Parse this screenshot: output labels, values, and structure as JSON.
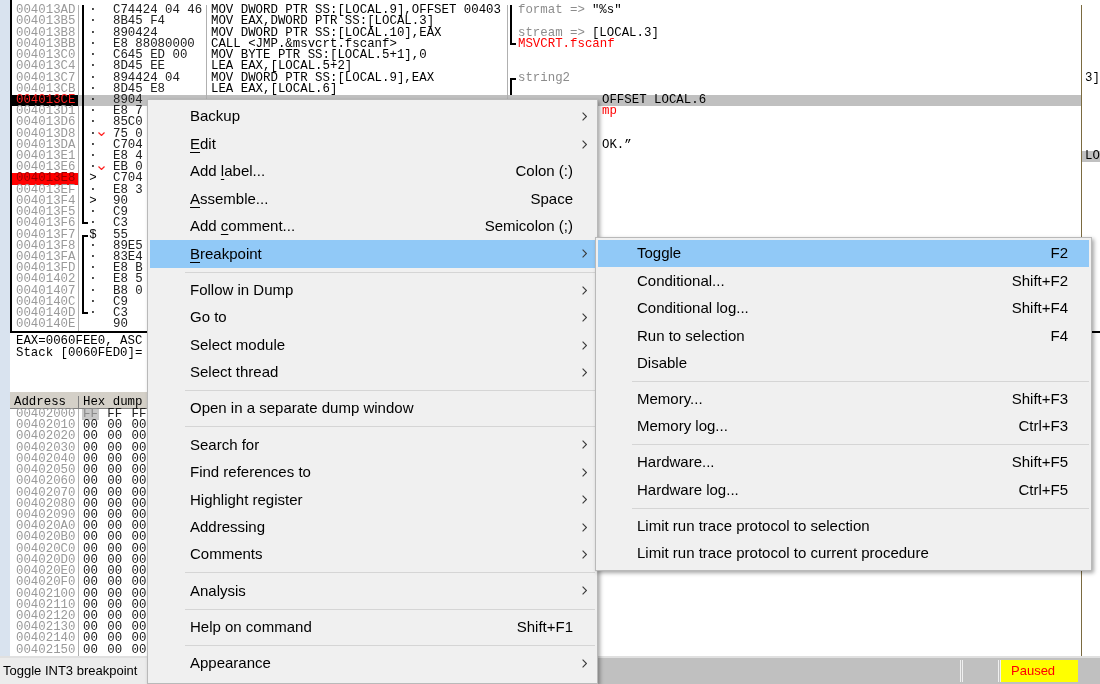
{
  "disassembly": {
    "rows": [
      {
        "address": "004013AD",
        "marker": "·",
        "jump": false,
        "bracket": {
          "kind": "middle"
        },
        "hex": "C74424 04 46",
        "instruction": "MOV DWORD PTR SS:[LOCAL.9],OFFSET 00403",
        "comment_bracket": {
          "kind": "middle"
        },
        "comment": {
          "kind": "arg",
          "name": "format =>",
          "value": "\"%s\""
        },
        "selected": false,
        "breakpoint": false
      },
      {
        "address": "004013B5",
        "marker": "·",
        "jump": false,
        "bracket": {
          "kind": "middle"
        },
        "hex": "8B45 F4",
        "instruction": "MOV EAX,DWORD PTR SS:[LOCAL.3]",
        "comment_bracket": {
          "kind": "middle"
        },
        "selected": false,
        "breakpoint": false
      },
      {
        "address": "004013B8",
        "marker": "·",
        "jump": false,
        "bracket": {
          "kind": "middle"
        },
        "hex": "890424",
        "instruction": "MOV DWORD PTR SS:[LOCAL.10],EAX",
        "comment_bracket": {
          "kind": "middle"
        },
        "comment": {
          "kind": "arg",
          "name": "stream =>",
          "value": "[LOCAL.3]"
        },
        "selected": false,
        "breakpoint": false
      },
      {
        "address": "004013BB",
        "marker": "·",
        "jump": false,
        "bracket": {
          "kind": "middle"
        },
        "hex": "E8 88080000",
        "instruction": "CALL <JMP.&msvcrt.fscanf>",
        "comment_bracket": {
          "kind": "end"
        },
        "comment": {
          "kind": "call",
          "text": "MSVCRT.fscanf"
        },
        "selected": false,
        "breakpoint": false
      },
      {
        "address": "004013C0",
        "marker": "·",
        "jump": false,
        "bracket": {
          "kind": "middle"
        },
        "hex": "C645 ED 00",
        "instruction": "MOV BYTE PTR SS:[LOCAL.5+1],0",
        "selected": false,
        "breakpoint": false
      },
      {
        "address": "004013C4",
        "marker": "·",
        "jump": false,
        "bracket": {
          "kind": "middle"
        },
        "hex": "8D45 EE",
        "instruction": "LEA EAX,[LOCAL.5+2]",
        "selected": false,
        "breakpoint": false
      },
      {
        "address": "004013C7",
        "marker": "·",
        "jump": false,
        "bracket": {
          "kind": "middle"
        },
        "hex": "894424 04",
        "instruction": "MOV DWORD PTR SS:[LOCAL.9],EAX",
        "comment_bracket": {
          "kind": "start"
        },
        "comment": {
          "kind": "arg",
          "name": "string2"
        },
        "edge": {
          "text": "3]",
          "selected": false
        },
        "selected": false,
        "breakpoint": false
      },
      {
        "address": "004013CB",
        "marker": "·",
        "jump": false,
        "bracket": {
          "kind": "middle"
        },
        "hex": "8D45 E8",
        "instruction": "LEA EAX,[LOCAL.6]",
        "comment_bracket": {
          "kind": "middle"
        },
        "selected": false,
        "breakpoint": false
      },
      {
        "address": "004013CE",
        "marker": "·",
        "jump": false,
        "bracket": {
          "kind": "middle"
        },
        "hex": "8904",
        "comment": {
          "kind": "text_tail",
          "text": "OFFSET LOCAL.6"
        },
        "selected": true,
        "breakpoint": false
      },
      {
        "address": "004013D1",
        "marker": "·",
        "jump": false,
        "bracket": {
          "kind": "middle"
        },
        "hex": "E8 7",
        "comment": {
          "kind": "call_tail",
          "text": "mp"
        },
        "selected": false,
        "breakpoint": false
      },
      {
        "address": "004013D6",
        "marker": "·",
        "jump": false,
        "bracket": {
          "kind": "middle"
        },
        "hex": "85C0",
        "selected": false,
        "breakpoint": false
      },
      {
        "address": "004013D8",
        "marker": "·",
        "jump": true,
        "bracket": {
          "kind": "middle"
        },
        "hex": "75 0",
        "selected": false,
        "breakpoint": false
      },
      {
        "address": "004013DA",
        "marker": "·",
        "jump": false,
        "bracket": {
          "kind": "middle"
        },
        "hex": "C704",
        "comment": {
          "kind": "text_tail",
          "text": "OK.”"
        },
        "selected": false,
        "breakpoint": false
      },
      {
        "address": "004013E1",
        "marker": "·",
        "jump": false,
        "bracket": {
          "kind": "middle"
        },
        "hex": "E8 4",
        "edge": {
          "text": "LO",
          "selected": true
        },
        "selected": false,
        "breakpoint": false
      },
      {
        "address": "004013E6",
        "marker": "·",
        "jump": true,
        "bracket": {
          "kind": "middle"
        },
        "hex": "EB 0",
        "selected": false,
        "breakpoint": false
      },
      {
        "address": "004013E8",
        "marker": ">",
        "jump": false,
        "bracket": {
          "kind": "middle"
        },
        "hex": "C704",
        "selected": false,
        "breakpoint": true
      },
      {
        "address": "004013EF",
        "marker": "·",
        "jump": false,
        "bracket": {
          "kind": "middle"
        },
        "hex": "E8 3",
        "selected": false,
        "breakpoint": false
      },
      {
        "address": "004013F4",
        "marker": ">",
        "jump": false,
        "bracket": {
          "kind": "middle"
        },
        "hex": "90",
        "selected": false,
        "breakpoint": false
      },
      {
        "address": "004013F5",
        "marker": "·",
        "jump": false,
        "bracket": {
          "kind": "middle"
        },
        "hex": "C9",
        "selected": false,
        "breakpoint": false
      },
      {
        "address": "004013F6",
        "marker": "·",
        "jump": false,
        "bracket": {
          "kind": "end"
        },
        "hex": "C3",
        "selected": false,
        "breakpoint": false
      },
      {
        "address": "004013F7",
        "marker": "$",
        "jump": false,
        "bracket": {
          "kind": "start"
        },
        "hex": "55",
        "selected": false,
        "breakpoint": false
      },
      {
        "address": "004013F8",
        "marker": "·",
        "jump": false,
        "bracket": {
          "kind": "middle"
        },
        "hex": "89E5",
        "selected": false,
        "breakpoint": false
      },
      {
        "address": "004013FA",
        "marker": "·",
        "jump": false,
        "bracket": {
          "kind": "middle"
        },
        "hex": "83E4",
        "selected": false,
        "breakpoint": false
      },
      {
        "address": "004013FD",
        "marker": "·",
        "jump": false,
        "bracket": {
          "kind": "middle"
        },
        "hex": "E8 B",
        "selected": false,
        "breakpoint": false
      },
      {
        "address": "00401402",
        "marker": "·",
        "jump": false,
        "bracket": {
          "kind": "middle"
        },
        "hex": "E8 5",
        "selected": false,
        "breakpoint": false
      },
      {
        "address": "00401407",
        "marker": "·",
        "jump": false,
        "bracket": {
          "kind": "middle"
        },
        "hex": "B8 0",
        "selected": false,
        "breakpoint": false
      },
      {
        "address": "0040140C",
        "marker": "·",
        "jump": false,
        "bracket": {
          "kind": "middle"
        },
        "hex": "C9",
        "selected": false,
        "breakpoint": false
      },
      {
        "address": "0040140D",
        "marker": "·",
        "jump": false,
        "bracket": {
          "kind": "end"
        },
        "hex": "C3",
        "selected": false,
        "breakpoint": false
      },
      {
        "address": "0040140E",
        "jump": false,
        "hex": "90",
        "selected": false,
        "breakpoint": false
      }
    ]
  },
  "info": {
    "lines": [
      "EAX=0060FEE0, ASC",
      "Stack [0060FED0]="
    ]
  },
  "dump": {
    "columns": [
      "Address",
      "Hex dump"
    ],
    "rows": [
      {
        "address": "00402000",
        "bytes": [
          {
            "value": "FF",
            "selected": true
          },
          {
            "value": "FF",
            "selected": false
          },
          {
            "value": "FF",
            "selected": false
          }
        ]
      },
      {
        "address": "00402010",
        "bytes": [
          {
            "value": "00",
            "selected": false
          },
          {
            "value": "00",
            "selected": false
          },
          {
            "value": "00",
            "selected": false
          }
        ]
      },
      {
        "address": "00402020",
        "bytes": [
          {
            "value": "00",
            "selected": false
          },
          {
            "value": "00",
            "selected": false
          },
          {
            "value": "00",
            "selected": false
          }
        ]
      },
      {
        "address": "00402030",
        "bytes": [
          {
            "value": "00",
            "selected": false
          },
          {
            "value": "00",
            "selected": false
          },
          {
            "value": "00",
            "selected": false
          }
        ]
      },
      {
        "address": "00402040",
        "bytes": [
          {
            "value": "00",
            "selected": false
          },
          {
            "value": "00",
            "selected": false
          },
          {
            "value": "00",
            "selected": false
          }
        ]
      },
      {
        "address": "00402050",
        "bytes": [
          {
            "value": "00",
            "selected": false
          },
          {
            "value": "00",
            "selected": false
          },
          {
            "value": "00",
            "selected": false
          }
        ]
      },
      {
        "address": "00402060",
        "bytes": [
          {
            "value": "00",
            "selected": false
          },
          {
            "value": "00",
            "selected": false
          },
          {
            "value": "00",
            "selected": false
          }
        ]
      },
      {
        "address": "00402070",
        "bytes": [
          {
            "value": "00",
            "selected": false
          },
          {
            "value": "00",
            "selected": false
          },
          {
            "value": "00",
            "selected": false
          }
        ]
      },
      {
        "address": "00402080",
        "bytes": [
          {
            "value": "00",
            "selected": false
          },
          {
            "value": "00",
            "selected": false
          },
          {
            "value": "00",
            "selected": false
          }
        ]
      },
      {
        "address": "00402090",
        "bytes": [
          {
            "value": "00",
            "selected": false
          },
          {
            "value": "00",
            "selected": false
          },
          {
            "value": "00",
            "selected": false
          }
        ]
      },
      {
        "address": "004020A0",
        "bytes": [
          {
            "value": "00",
            "selected": false
          },
          {
            "value": "00",
            "selected": false
          },
          {
            "value": "00",
            "selected": false
          }
        ]
      },
      {
        "address": "004020B0",
        "bytes": [
          {
            "value": "00",
            "selected": false
          },
          {
            "value": "00",
            "selected": false
          },
          {
            "value": "00",
            "selected": false
          }
        ]
      },
      {
        "address": "004020C0",
        "bytes": [
          {
            "value": "00",
            "selected": false
          },
          {
            "value": "00",
            "selected": false
          },
          {
            "value": "00",
            "selected": false
          }
        ]
      },
      {
        "address": "004020D0",
        "bytes": [
          {
            "value": "00",
            "selected": false
          },
          {
            "value": "00",
            "selected": false
          },
          {
            "value": "00",
            "selected": false
          }
        ]
      },
      {
        "address": "004020E0",
        "bytes": [
          {
            "value": "00",
            "selected": false
          },
          {
            "value": "00",
            "selected": false
          },
          {
            "value": "00",
            "selected": false
          }
        ]
      },
      {
        "address": "004020F0",
        "bytes": [
          {
            "value": "00",
            "selected": false
          },
          {
            "value": "00",
            "selected": false
          },
          {
            "value": "00",
            "selected": false
          }
        ]
      },
      {
        "address": "00402100",
        "bytes": [
          {
            "value": "00",
            "selected": false
          },
          {
            "value": "00",
            "selected": false
          },
          {
            "value": "00",
            "selected": false
          }
        ]
      },
      {
        "address": "00402110",
        "bytes": [
          {
            "value": "00",
            "selected": false
          },
          {
            "value": "00",
            "selected": false
          },
          {
            "value": "00",
            "selected": false
          }
        ]
      },
      {
        "address": "00402120",
        "bytes": [
          {
            "value": "00",
            "selected": false
          },
          {
            "value": "00",
            "selected": false
          },
          {
            "value": "00",
            "selected": false
          }
        ]
      },
      {
        "address": "00402130",
        "bytes": [
          {
            "value": "00",
            "selected": false
          },
          {
            "value": "00",
            "selected": false
          },
          {
            "value": "00",
            "selected": false
          }
        ]
      },
      {
        "address": "00402140",
        "bytes": [
          {
            "value": "00",
            "selected": false
          },
          {
            "value": "00",
            "selected": false
          },
          {
            "value": "00",
            "selected": false
          }
        ]
      },
      {
        "address": "00402150",
        "bytes": [
          {
            "value": "00",
            "selected": false
          },
          {
            "value": "00",
            "selected": false
          },
          {
            "value": "00",
            "selected": false
          }
        ]
      }
    ]
  },
  "status_bar": {
    "message": "Toggle INT3 breakpoint",
    "state": "Paused"
  },
  "context_menu": {
    "sections": [
      {
        "items": [
          {
            "label": "Backup",
            "submenu": true,
            "selected": false
          },
          {
            "label_parts": [
              {
                "text": "E",
                "underlined": true
              },
              {
                "text": "dit",
                "underlined": false
              }
            ],
            "submenu": true,
            "selected": false
          },
          {
            "label_parts": [
              {
                "text": "Add ",
                "underlined": false
              },
              {
                "text": "l",
                "underlined": true
              },
              {
                "text": "abel...",
                "underlined": false
              }
            ],
            "shortcut": "Colon (:)",
            "submenu": false,
            "selected": false
          },
          {
            "label_parts": [
              {
                "text": "A",
                "underlined": true
              },
              {
                "text": "ssemble...",
                "underlined": false
              }
            ],
            "shortcut": "Space",
            "submenu": false,
            "selected": false
          },
          {
            "label_parts": [
              {
                "text": "Add ",
                "underlined": false
              },
              {
                "text": "c",
                "underlined": true
              },
              {
                "text": "omment...",
                "underlined": false
              }
            ],
            "shortcut": "Semicolon (;)",
            "submenu": false,
            "selected": false
          },
          {
            "label_parts": [
              {
                "text": "B",
                "underlined": true
              },
              {
                "text": "reakpoint",
                "underlined": false
              }
            ],
            "submenu": true,
            "selected": true
          }
        ]
      },
      {
        "items": [
          {
            "label": "Follow in Dump",
            "submenu": true,
            "selected": false
          },
          {
            "label": "Go to",
            "submenu": true,
            "selected": false
          },
          {
            "label": "Select module",
            "submenu": true,
            "selected": false
          },
          {
            "label": "Select thread",
            "submenu": true,
            "selected": false
          }
        ]
      },
      {
        "items": [
          {
            "label": "Open in a separate dump window",
            "submenu": false,
            "selected": false
          }
        ]
      },
      {
        "items": [
          {
            "label": "Search for",
            "submenu": true,
            "selected": false
          },
          {
            "label": "Find references to",
            "submenu": true,
            "selected": false
          },
          {
            "label": "Highlight register",
            "submenu": true,
            "selected": false
          },
          {
            "label": "Addressing",
            "submenu": true,
            "selected": false
          },
          {
            "label": "Comments",
            "submenu": true,
            "selected": false
          }
        ]
      },
      {
        "items": [
          {
            "label": "Analysis",
            "submenu": true,
            "selected": false
          }
        ]
      },
      {
        "items": [
          {
            "label": "Help on command",
            "shortcut": "Shift+F1",
            "submenu": false,
            "selected": false
          }
        ]
      },
      {
        "items": [
          {
            "label": "Appearance",
            "submenu": true,
            "selected": false
          }
        ]
      }
    ]
  },
  "submenu": {
    "sections": [
      {
        "items": [
          {
            "label": "Toggle",
            "shortcut": "F2",
            "selected": true
          },
          {
            "label": "Conditional...",
            "shortcut": "Shift+F2",
            "selected": false
          },
          {
            "label": "Conditional log...",
            "shortcut": "Shift+F4",
            "selected": false
          },
          {
            "label": "Run to selection",
            "shortcut": "F4",
            "selected": false
          },
          {
            "label": "Disable",
            "selected": false
          }
        ]
      },
      {
        "items": [
          {
            "label": "Memory...",
            "shortcut": "Shift+F3",
            "selected": false
          },
          {
            "label": "Memory log...",
            "shortcut": "Ctrl+F3",
            "selected": false
          }
        ]
      },
      {
        "items": [
          {
            "label": "Hardware...",
            "shortcut": "Shift+F5",
            "selected": false
          },
          {
            "label": "Hardware log...",
            "shortcut": "Ctrl+F5",
            "selected": false
          }
        ]
      },
      {
        "items": [
          {
            "label": "Limit run trace protocol to selection",
            "selected": false
          },
          {
            "label": "Limit run trace protocol to current procedure",
            "selected": false
          }
        ]
      }
    ]
  }
}
